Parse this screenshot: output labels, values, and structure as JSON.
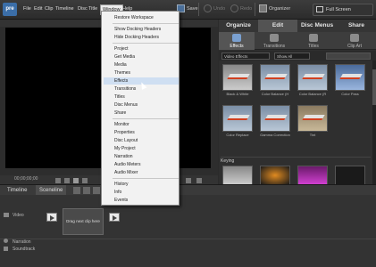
{
  "app": {
    "logo_text": "pre"
  },
  "menubar": {
    "items": [
      "File",
      "Edit",
      "Clip",
      "Timeline",
      "Disc",
      "Title",
      "Window",
      "Help"
    ],
    "open_item": "Window"
  },
  "toolbar": {
    "save": "Save",
    "undo": "Undo",
    "redo": "Redo",
    "organizer": "Organizer",
    "full_screen": "Full Screen"
  },
  "window_menu": {
    "groups": [
      [
        "Restore Workspace"
      ],
      [
        "Show Docking Headers",
        "Hide Docking Headers"
      ],
      [
        "Project",
        "Get Media",
        "Media",
        "Themes",
        "Effects",
        "Transitions",
        "Titles",
        "Disc Menus",
        "Share"
      ],
      [
        "Monitor",
        "Properties",
        "Disc Layout",
        "My Project",
        "Narration",
        "Audio Meters",
        "Audio Mixer"
      ],
      [
        "History",
        "Info",
        "Events"
      ]
    ],
    "highlighted": "Effects"
  },
  "monitor": {
    "timecode": "00;00;00;00"
  },
  "right_panel": {
    "tabs": [
      "Organize",
      "Edit",
      "Disc Menus",
      "Share"
    ],
    "active_tab": "Edit",
    "subtabs": [
      "Effects",
      "Transitions",
      "Titles",
      "Clip Art"
    ],
    "active_subtab": "Effects",
    "filter_category": "Video Effects",
    "filter_show": "Show All",
    "thumbnails": [
      "Black & White",
      "Color Balance (H",
      "Color Balance (R",
      "Color Pass",
      "Color Replace",
      "Gamma Correction",
      "Tint"
    ],
    "section": "Keying"
  },
  "timeline": {
    "tabs": [
      "Timeline",
      "Sceneline"
    ],
    "active_tab": "Sceneline",
    "video_label": "Video",
    "drop_hint": "Drag next clip here",
    "narration_label": "Narration",
    "soundtrack_label": "Soundtrack"
  },
  "colors": {
    "accent": "#3b6ea8",
    "menu_highlight": "#cfdff2",
    "panel": "#2f2f2f"
  }
}
